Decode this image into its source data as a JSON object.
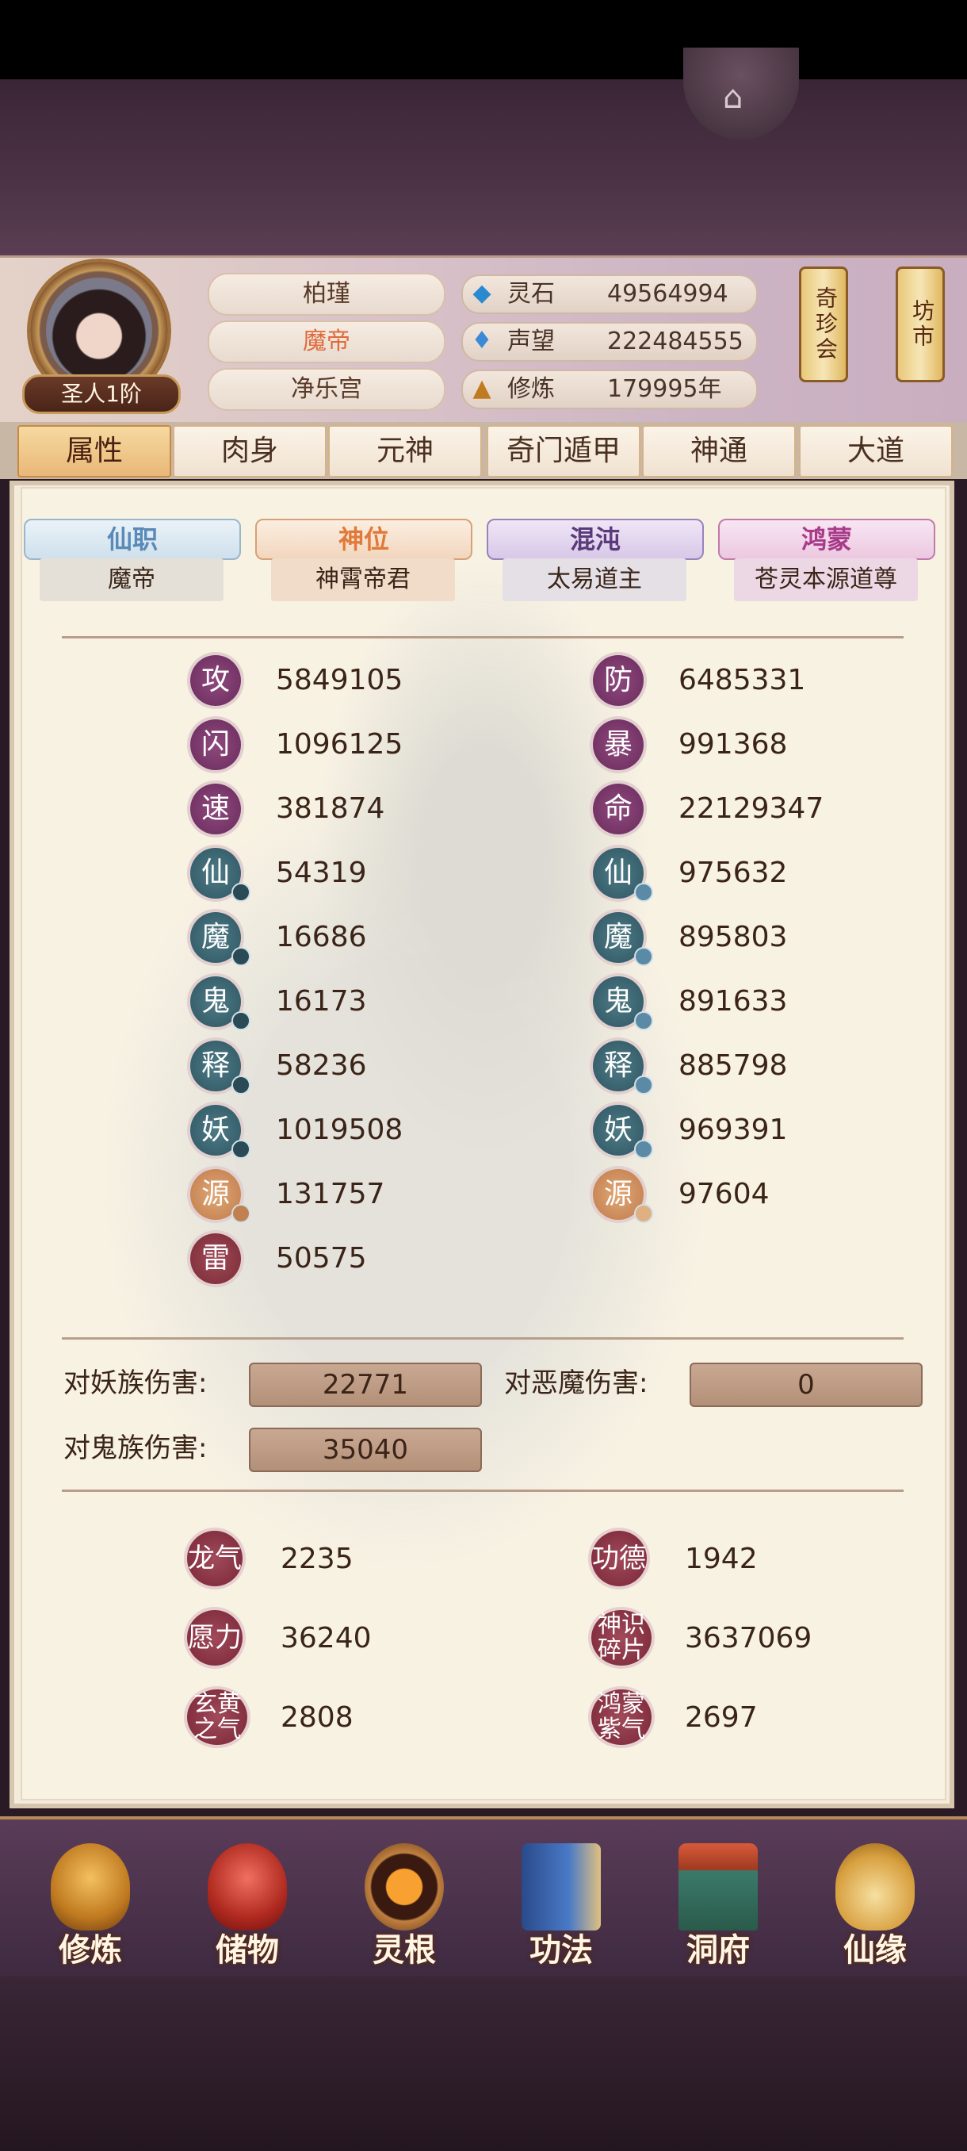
{
  "header": {
    "name": "柏瑾",
    "title": "魔帝",
    "sect": "净乐宫",
    "rank": "圣人1阶",
    "resources": [
      {
        "icon": "spirit-stone-icon",
        "label": "灵石",
        "value": "49564994"
      },
      {
        "icon": "prestige-icon",
        "label": "声望",
        "value": "222484555"
      },
      {
        "icon": "cultivate-icon",
        "label": "修炼",
        "value": "179995年"
      }
    ],
    "shop_buttons": [
      "奇珍会",
      "坊市"
    ]
  },
  "tabs": [
    "属性",
    "肉身",
    "元神",
    "奇门遁甲",
    "神通",
    "大道"
  ],
  "active_tab": "属性",
  "ranks": [
    {
      "label": "仙职",
      "value": "魔帝",
      "color": "#6fa0c8"
    },
    {
      "label": "神位",
      "value": "神霄帝君",
      "color": "#e08a48"
    },
    {
      "label": "混沌",
      "value": "太易道主",
      "color": "#6a4a8a"
    },
    {
      "label": "鸿蒙",
      "value": "苍灵本源道尊",
      "color": "#b04a9a"
    }
  ],
  "stats_left": [
    {
      "icon": "攻",
      "value": "5849105",
      "style": "purple",
      "badge": false
    },
    {
      "icon": "闪",
      "value": "1096125",
      "style": "purple",
      "badge": false
    },
    {
      "icon": "速",
      "value": "381874",
      "style": "purple",
      "badge": false
    },
    {
      "icon": "仙",
      "value": "54319",
      "style": "teal",
      "badge": true
    },
    {
      "icon": "魔",
      "value": "16686",
      "style": "teal",
      "badge": true
    },
    {
      "icon": "鬼",
      "value": "16173",
      "style": "teal",
      "badge": true
    },
    {
      "icon": "释",
      "value": "58236",
      "style": "teal",
      "badge": true
    },
    {
      "icon": "妖",
      "value": "1019508",
      "style": "teal",
      "badge": true
    },
    {
      "icon": "源",
      "value": "131757",
      "style": "gold",
      "badge": true
    },
    {
      "icon": "雷",
      "value": "50575",
      "style": "red",
      "badge": false
    }
  ],
  "stats_right": [
    {
      "icon": "防",
      "value": "6485331",
      "style": "purple",
      "badge": false
    },
    {
      "icon": "暴",
      "value": "991368",
      "style": "purple",
      "badge": false
    },
    {
      "icon": "命",
      "value": "22129347",
      "style": "purple",
      "badge": false
    },
    {
      "icon": "仙",
      "value": "975632",
      "style": "teal",
      "badge": true
    },
    {
      "icon": "魔",
      "value": "895803",
      "style": "teal",
      "badge": true
    },
    {
      "icon": "鬼",
      "value": "891633",
      "style": "teal",
      "badge": true
    },
    {
      "icon": "释",
      "value": "885798",
      "style": "teal",
      "badge": true
    },
    {
      "icon": "妖",
      "value": "969391",
      "style": "teal",
      "badge": true
    },
    {
      "icon": "源",
      "value": "97604",
      "style": "gold",
      "badge": true
    }
  ],
  "damage": [
    {
      "label": "对妖族伤害:",
      "value": "22771"
    },
    {
      "label": "对恶魔伤害:",
      "value": "0"
    },
    {
      "label": "对鬼族伤害:",
      "value": "35040"
    }
  ],
  "resources_extra": [
    {
      "icon": "龙气",
      "value": "2235"
    },
    {
      "icon": "功德",
      "value": "1942"
    },
    {
      "icon": "愿力",
      "value": "36240"
    },
    {
      "icon": "神识碎片",
      "value": "3637069"
    },
    {
      "icon": "玄黄之气",
      "value": "2808"
    },
    {
      "icon": "鸿蒙紫气",
      "value": "2697"
    }
  ],
  "nav": [
    "修炼",
    "储物",
    "灵根",
    "功法",
    "洞府",
    "仙缘"
  ]
}
